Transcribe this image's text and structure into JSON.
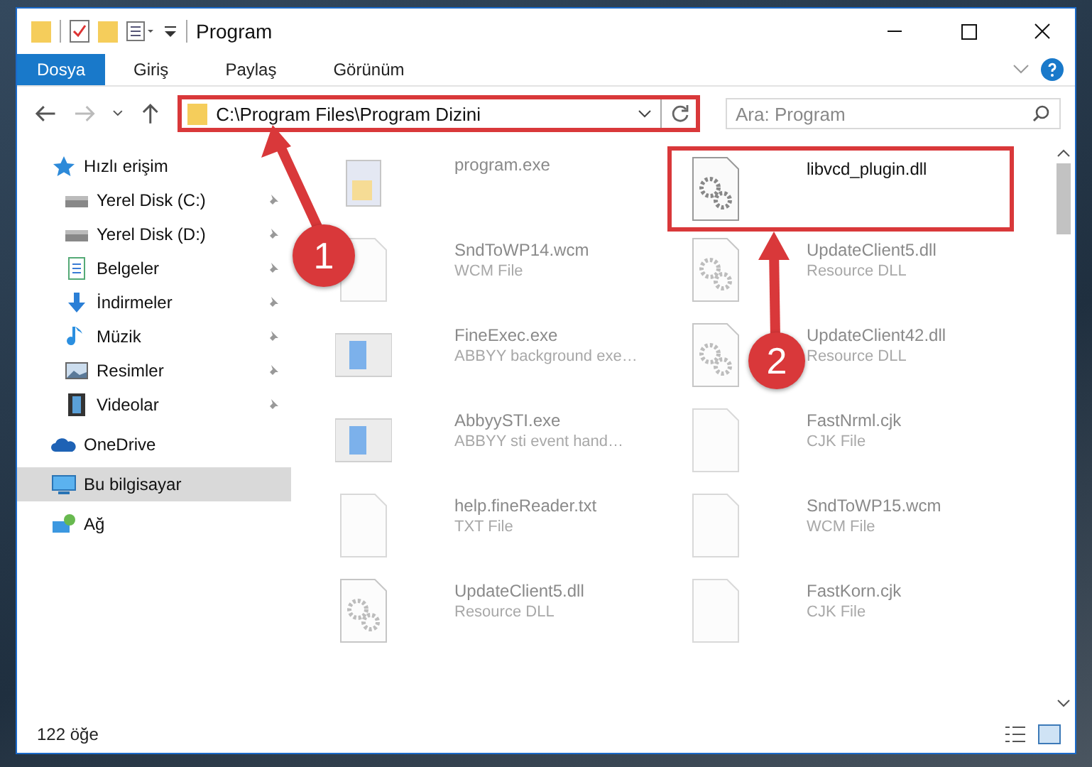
{
  "window": {
    "title": "Program"
  },
  "ribbon_tabs": [
    {
      "label": "Dosya",
      "selected": true
    },
    {
      "label": "Giriş",
      "selected": false
    },
    {
      "label": "Paylaş",
      "selected": false
    },
    {
      "label": "Görünüm",
      "selected": false
    }
  ],
  "address_bar": {
    "path": "C:\\Program Files\\Program Dizini",
    "highlighted": true
  },
  "search": {
    "placeholder": "Ara: Program"
  },
  "sidebar": {
    "items": [
      {
        "label": "Hızlı erişim",
        "kind": "star",
        "selected": false,
        "children": [
          {
            "label": "Yerel Disk (C:)",
            "kind": "drive",
            "pinned": true
          },
          {
            "label": "Yerel Disk (D:)",
            "kind": "drive",
            "pinned": true
          },
          {
            "label": "Belgeler",
            "kind": "document",
            "pinned": true
          },
          {
            "label": "İndirmeler",
            "kind": "download",
            "pinned": true
          },
          {
            "label": "Müzik",
            "kind": "music",
            "pinned": true
          },
          {
            "label": "Resimler",
            "kind": "picture",
            "pinned": true
          },
          {
            "label": "Videolar",
            "kind": "video",
            "pinned": true
          }
        ]
      },
      {
        "label": "OneDrive",
        "kind": "cloud",
        "selected": false
      },
      {
        "label": "Bu bilgisayar",
        "kind": "computer",
        "selected": true
      },
      {
        "label": "Ağ",
        "kind": "network",
        "selected": false
      }
    ]
  },
  "files": [
    {
      "name": "program.exe",
      "kind": "installer",
      "blurred": true,
      "highlighted": false
    },
    {
      "name": "libvcd_plugin.dll",
      "kind": "gears",
      "blurred": false,
      "highlighted": true
    },
    {
      "name": "SndToWP14.wcm",
      "type": "WCM File",
      "kind": "blank",
      "blurred": true,
      "highlighted": false
    },
    {
      "name": "UpdateClient5.dll",
      "type": "Resource DLL",
      "kind": "gears",
      "blurred": true,
      "highlighted": false
    },
    {
      "name": "FineExec.exe",
      "type": "ABBYY background exe…",
      "kind": "app",
      "blurred": true,
      "highlighted": false
    },
    {
      "name": "UpdateClient42.dll",
      "type": "Resource DLL",
      "kind": "gears",
      "blurred": true,
      "highlighted": false
    },
    {
      "name": "AbbyySTI.exe",
      "type": "ABBYY sti event hand…",
      "kind": "app",
      "blurred": true,
      "highlighted": false
    },
    {
      "name": "FastNrml.cjk",
      "type": "CJK File",
      "kind": "blank",
      "blurred": true,
      "highlighted": false
    },
    {
      "name": "help.fineReader.txt",
      "type": "TXT File",
      "kind": "blank",
      "blurred": true,
      "highlighted": false
    },
    {
      "name": "SndToWP15.wcm",
      "type": "WCM File",
      "kind": "blank",
      "blurred": true,
      "highlighted": false
    },
    {
      "name": "UpdateClient5.dll",
      "type": "Resource DLL",
      "kind": "gears",
      "blurred": true,
      "highlighted": false
    },
    {
      "name": "FastKorn.cjk",
      "type": "CJK File",
      "kind": "blank",
      "blurred": true,
      "highlighted": false
    }
  ],
  "status_bar": {
    "item_count": "122 öğe"
  },
  "annotations": [
    {
      "label": "1",
      "kind": "arrow"
    },
    {
      "label": "2",
      "kind": "arrow"
    }
  ]
}
